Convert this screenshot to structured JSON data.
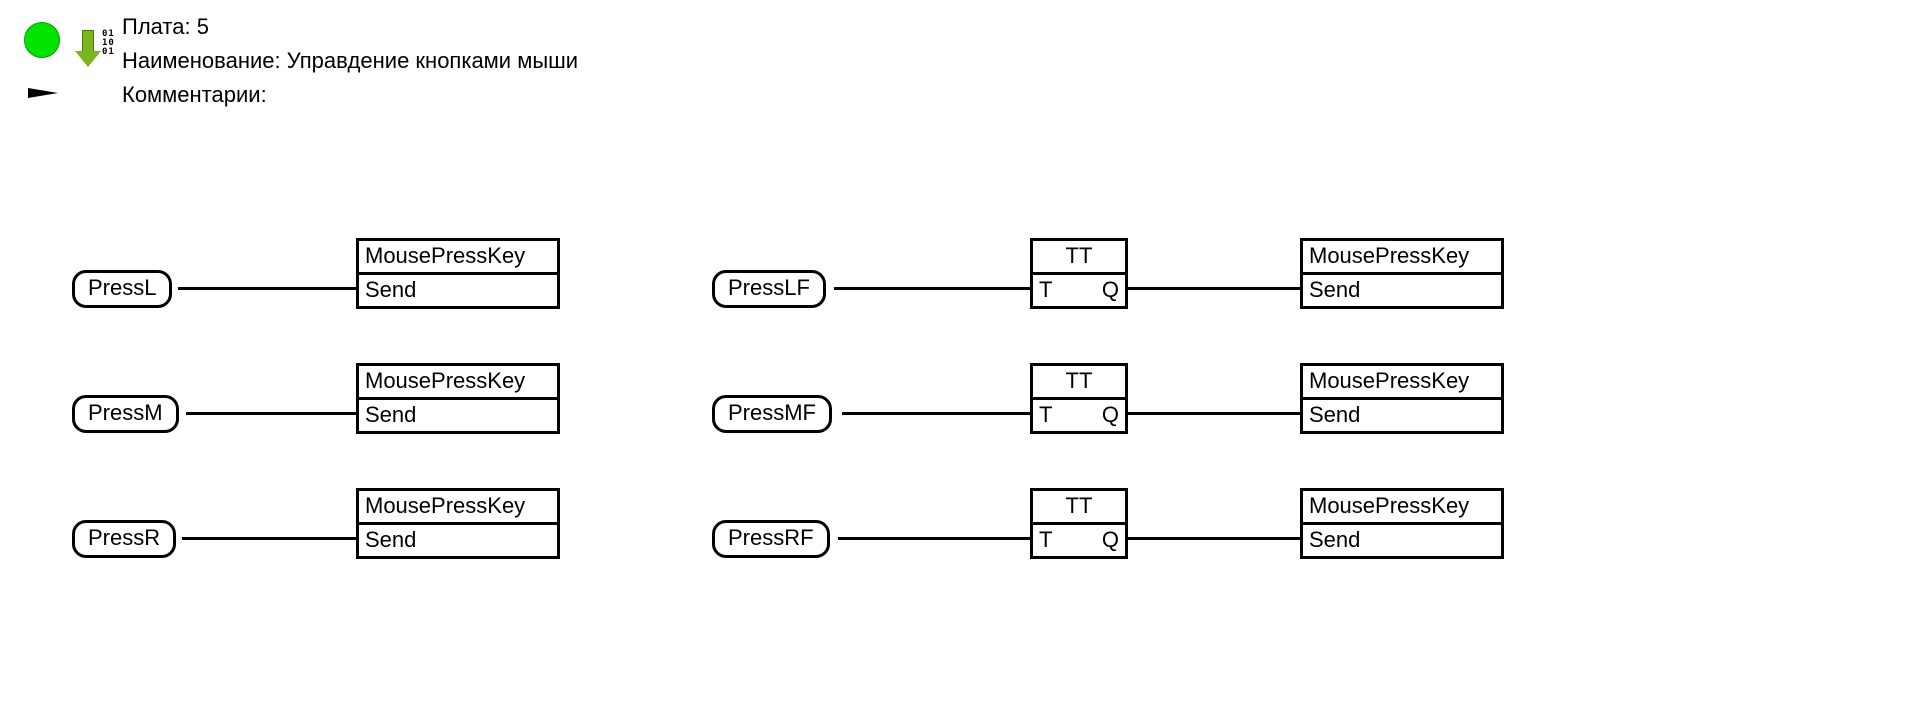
{
  "header": {
    "board_label": "Плата:",
    "board_value": "5",
    "name_label": "Наименование:",
    "name_value": "Управдение кнопками мыши",
    "comments_label": "Комментарии:",
    "comments_value": "",
    "bits_row1": "01",
    "bits_row2": "10",
    "bits_row3": "01"
  },
  "blocks": {
    "mpk_title": "MousePressKey",
    "mpk_port": "Send",
    "tt_title": "TT",
    "tt_in": "T",
    "tt_out": "Q"
  },
  "tags": {
    "l": "PressL",
    "m": "PressM",
    "r": "PressR",
    "lf": "PressLF",
    "mf": "PressMF",
    "rf": "PressRF"
  }
}
